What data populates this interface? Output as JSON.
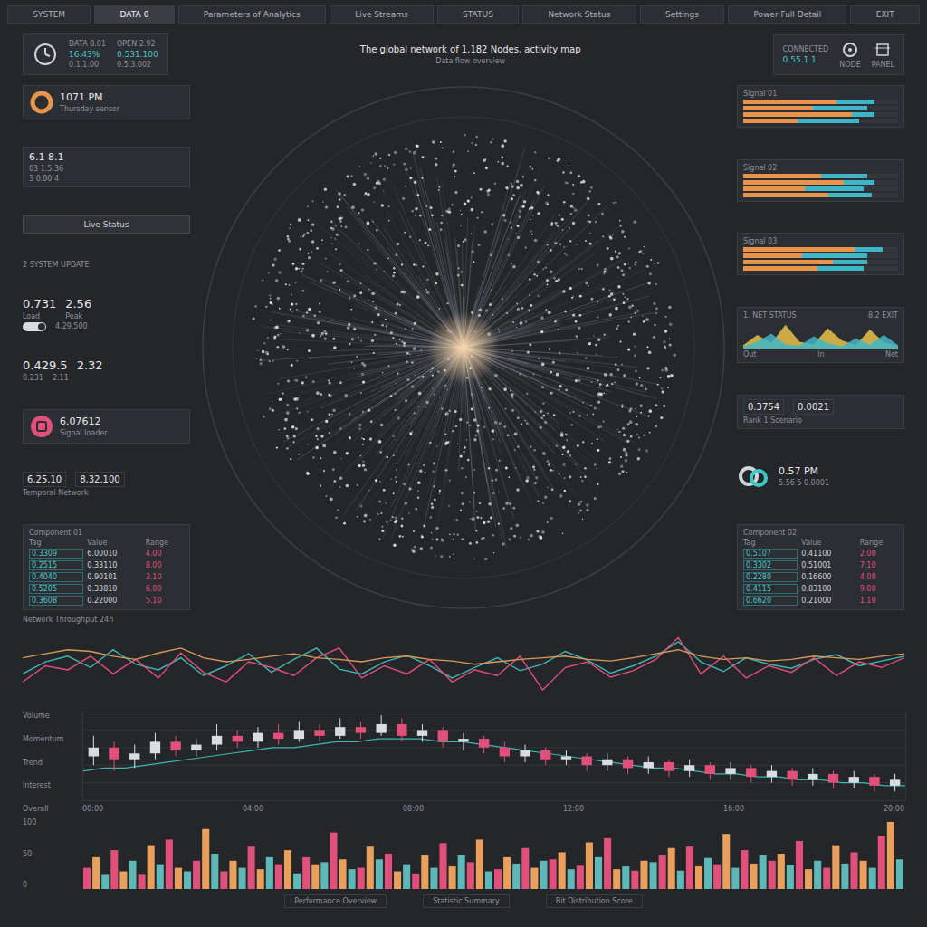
{
  "top_bar": [
    {
      "label": "SYSTEM",
      "selected": false
    },
    {
      "label": "DATA 0",
      "selected": true
    },
    {
      "label": "Parameters of Analytics",
      "selected": false
    },
    {
      "label": "Live Streams",
      "selected": false
    },
    {
      "label": "STATUS",
      "selected": false
    },
    {
      "label": "Network Status",
      "selected": false
    },
    {
      "label": "Settings",
      "selected": false
    },
    {
      "label": "Power Full Detail",
      "selected": false
    },
    {
      "label": "EXIT",
      "selected": false
    }
  ],
  "header": {
    "title": "The global network of 1,182 Nodes, activity map",
    "subtitle": "Data flow overview"
  },
  "header_left": {
    "stats": [
      {
        "label": "DATA 8.01",
        "value": "16.43%",
        "sub": "0.1.1.00"
      },
      {
        "label": "OPEN 2.92",
        "value": "0.531.100",
        "sub": "0.5.3.002"
      }
    ]
  },
  "header_right": {
    "stats": [
      {
        "label": "CONNECTED",
        "value": "0.55.1.1"
      }
    ],
    "captions": [
      "NODE",
      "PANEL"
    ]
  },
  "left": {
    "clock_card": {
      "time": "1071 PM",
      "caption": "Thursday sensor"
    },
    "metric_card": {
      "value": "6.1 8.1",
      "lines": [
        "03 1.5.36",
        "3 0.00 4"
      ]
    },
    "status_button": "Live Status",
    "section_label": "2 SYSTEM UPDATE",
    "metrics_a": {
      "values": [
        "0.731",
        "2.56"
      ],
      "labels": [
        "Load",
        "Peak"
      ],
      "toggle": {
        "on": true
      },
      "toggle_label": "4.29.500"
    },
    "metrics_b": {
      "values": [
        "0.429.5",
        "2.32"
      ],
      "sub": "0.231",
      "extra": "2.11"
    },
    "alert_card": {
      "value": "6.07612",
      "caption": "Signal loader"
    },
    "metrics_c": {
      "values": [
        "6.25.10",
        "8.32.100"
      ],
      "sub": "Temporal Network"
    },
    "table": {
      "title": "Component 01",
      "columns": [
        "Tag",
        "Value",
        "Range"
      ],
      "rows": [
        {
          "tag": "0.3309",
          "value": "6.00010",
          "range": "4.00"
        },
        {
          "tag": "0.2515",
          "value": "0.33110",
          "range": "8.00"
        },
        {
          "tag": "0.4040",
          "value": "0.90101",
          "range": "3.10"
        },
        {
          "tag": "0.5205",
          "value": "0.33810",
          "range": "6.00"
        },
        {
          "tag": "0.3608",
          "value": "0.22000",
          "range": "5.10"
        }
      ]
    }
  },
  "right": {
    "bar_panels": [
      {
        "title": "Signal 01",
        "colors": [
          "#e8944a",
          "#3fb6c8"
        ],
        "rows": [
          [
            60,
            25
          ],
          [
            45,
            35
          ],
          [
            70,
            15
          ],
          [
            35,
            40
          ]
        ]
      },
      {
        "title": "Signal 02",
        "colors": [
          "#e8944a",
          "#3fb6c8"
        ],
        "rows": [
          [
            50,
            30
          ],
          [
            65,
            20
          ],
          [
            40,
            38
          ],
          [
            55,
            28
          ]
        ]
      },
      {
        "title": "Signal 03",
        "colors": [
          "#e8944a",
          "#3fb6c8"
        ],
        "rows": [
          [
            72,
            18
          ],
          [
            38,
            42
          ],
          [
            58,
            22
          ],
          [
            48,
            30
          ]
        ]
      }
    ],
    "net_status": {
      "title": "1. NET STATUS",
      "action": "8.2 EXIT",
      "series": [
        {
          "color": "#e8c14a",
          "values": [
            5,
            20,
            8,
            35,
            10,
            6,
            30,
            12,
            5,
            28,
            9,
            4
          ]
        },
        {
          "color": "#3fb6c8",
          "values": [
            3,
            10,
            22,
            6,
            4,
            18,
            8,
            3,
            15,
            6,
            20,
            5
          ]
        }
      ],
      "labels": [
        "Out",
        "In",
        "Net"
      ]
    },
    "readings": {
      "values": [
        "0.3754",
        "0.0021"
      ],
      "caption": "Rank 1 Scenario"
    },
    "rings_card": {
      "value": "0.57 PM",
      "caption": "5.56 5 0.0001"
    },
    "table": {
      "title": "Component 02",
      "columns": [
        "Tag",
        "Value",
        "Range"
      ],
      "rows": [
        {
          "tag": "0.5107",
          "value": "0.41100",
          "range": "2.00"
        },
        {
          "tag": "0.3302",
          "value": "0.51001",
          "range": "7.10"
        },
        {
          "tag": "0.2280",
          "value": "0.16600",
          "range": "4.00"
        },
        {
          "tag": "0.4115",
          "value": "0.83100",
          "range": "9.00"
        },
        {
          "tag": "0.6620",
          "value": "0.21000",
          "range": "1.10"
        }
      ]
    }
  },
  "line_chart": {
    "title": "Network Throughput 24h",
    "series": [
      {
        "name": "Teal",
        "color": "#3fb6b0",
        "values": [
          40,
          55,
          62,
          48,
          70,
          52,
          45,
          60,
          38,
          50,
          65,
          42,
          58,
          72,
          46,
          40,
          55,
          63,
          50,
          35,
          48,
          60,
          44,
          52,
          68,
          57,
          41,
          50,
          62,
          80,
          55,
          43,
          60,
          52,
          47,
          58,
          64,
          50,
          56,
          62
        ]
      },
      {
        "name": "Pink",
        "color": "#e0507a",
        "values": [
          30,
          50,
          45,
          62,
          40,
          58,
          35,
          66,
          42,
          30,
          55,
          48,
          38,
          60,
          72,
          35,
          50,
          40,
          58,
          30,
          45,
          38,
          62,
          20,
          48,
          55,
          36,
          44,
          58,
          85,
          40,
          62,
          35,
          50,
          42,
          60,
          38,
          55,
          48,
          60
        ]
      },
      {
        "name": "Orange",
        "color": "#d89a5a",
        "values": [
          60,
          65,
          70,
          68,
          62,
          58,
          66,
          72,
          60,
          55,
          58,
          62,
          65,
          60,
          58,
          55,
          60,
          62,
          58,
          56,
          52,
          55,
          58,
          60,
          62,
          58,
          56,
          60,
          65,
          70,
          62,
          58,
          60,
          56,
          58,
          62,
          60,
          58,
          62,
          65
        ]
      }
    ]
  },
  "candle_chart": {
    "y_ticks": [
      "Volume",
      "Momentum",
      "Trend",
      "Interest",
      "Overall"
    ],
    "x_ticks": [
      "00:00",
      "04:00",
      "08:00",
      "12:00",
      "16:00",
      "20:00"
    ],
    "up_color": "#d8dde2",
    "down_color": "#e0507a",
    "candles": [
      [
        55,
        58,
        62,
        52
      ],
      [
        58,
        54,
        60,
        50
      ],
      [
        54,
        56,
        59,
        51
      ],
      [
        56,
        60,
        63,
        54
      ],
      [
        60,
        57,
        62,
        55
      ],
      [
        57,
        59,
        61,
        55
      ],
      [
        59,
        62,
        66,
        57
      ],
      [
        62,
        60,
        64,
        58
      ],
      [
        60,
        63,
        65,
        58
      ],
      [
        63,
        61,
        66,
        59
      ],
      [
        61,
        64,
        67,
        60
      ],
      [
        64,
        62,
        66,
        60
      ],
      [
        62,
        65,
        68,
        61
      ],
      [
        65,
        63,
        67,
        61
      ],
      [
        63,
        66,
        69,
        62
      ],
      [
        66,
        62,
        68,
        60
      ],
      [
        62,
        64,
        66,
        60
      ],
      [
        64,
        60,
        65,
        58
      ],
      [
        60,
        61,
        63,
        57
      ],
      [
        61,
        58,
        62,
        56
      ],
      [
        58,
        55,
        60,
        53
      ],
      [
        55,
        57,
        59,
        53
      ],
      [
        57,
        54,
        58,
        52
      ],
      [
        54,
        55,
        57,
        52
      ],
      [
        55,
        52,
        56,
        50
      ],
      [
        52,
        54,
        56,
        50
      ],
      [
        54,
        51,
        55,
        49
      ],
      [
        51,
        53,
        55,
        49
      ],
      [
        53,
        50,
        54,
        48
      ],
      [
        50,
        52,
        54,
        48
      ],
      [
        52,
        49,
        53,
        47
      ],
      [
        49,
        51,
        53,
        47
      ],
      [
        51,
        48,
        52,
        46
      ],
      [
        48,
        50,
        52,
        46
      ],
      [
        50,
        47,
        51,
        45
      ],
      [
        47,
        49,
        51,
        45
      ],
      [
        49,
        46,
        50,
        44
      ],
      [
        46,
        48,
        50,
        44
      ],
      [
        48,
        45,
        49,
        43
      ],
      [
        45,
        47,
        49,
        43
      ]
    ],
    "trend": {
      "color": "#3fb6b0",
      "values": [
        50,
        51,
        51,
        52,
        53,
        54,
        55,
        56,
        57,
        58,
        58,
        59,
        60,
        60,
        61,
        61,
        61,
        60,
        60,
        59,
        58,
        57,
        56,
        55,
        54,
        53,
        52,
        51,
        51,
        50,
        49,
        49,
        48,
        48,
        47,
        47,
        46,
        46,
        45,
        45
      ]
    }
  },
  "bar_chart": {
    "y_ticks": [
      "100",
      "50",
      "0"
    ],
    "series": [
      {
        "color": "#e0507a",
        "values": [
          30,
          55,
          20,
          70,
          40,
          25,
          60,
          35,
          45,
          80,
          30,
          50,
          22,
          65,
          38,
          28,
          58,
          42,
          33,
          72,
          26,
          48,
          60,
          35,
          55,
          40,
          68,
          30,
          52,
          75
        ]
      },
      {
        "color": "#e8a05c",
        "values": [
          45,
          25,
          62,
          30,
          85,
          40,
          28,
          55,
          35,
          42,
          60,
          25,
          48,
          32,
          70,
          45,
          30,
          52,
          66,
          28,
          40,
          58,
          32,
          78,
          36,
          50,
          28,
          62,
          40,
          95
        ]
      },
      {
        "color": "#5fb8b8",
        "values": [
          20,
          40,
          35,
          25,
          50,
          30,
          45,
          22,
          38,
          28,
          42,
          35,
          30,
          48,
          25,
          36,
          40,
          28,
          45,
          32,
          38,
          26,
          44,
          30,
          48,
          34,
          40,
          36,
          30,
          42
        ]
      }
    ]
  },
  "footer": [
    "Performance Overview",
    "Statistic Summary",
    "Bit Distribution Score"
  ]
}
